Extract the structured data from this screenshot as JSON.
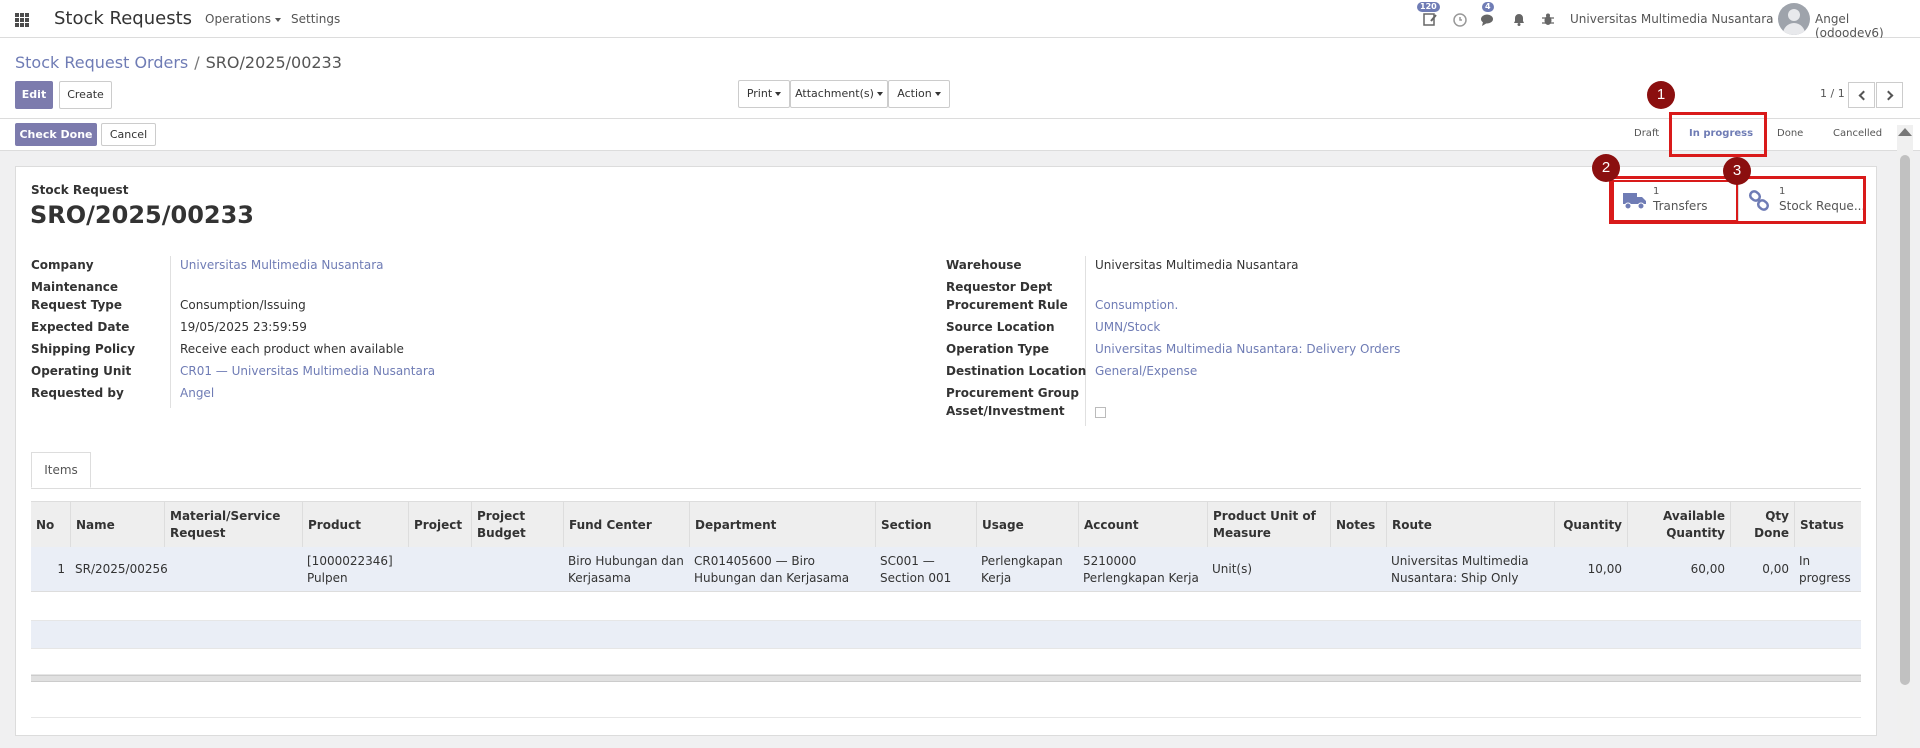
{
  "navbar": {
    "app_title": "Stock Requests",
    "menu_operations": "Operations",
    "menu_settings": "Settings",
    "activity_badge": "120",
    "messages_badge": "4",
    "company": "Universitas Multimedia Nusantara",
    "user": "Angel (odoodev6)"
  },
  "breadcrumb": {
    "parent": "Stock Request Orders",
    "separator": "/",
    "current": "SRO/2025/00233"
  },
  "toolbar": {
    "edit": "Edit",
    "create": "Create",
    "print": "Print",
    "attachments": "Attachment(s)",
    "action": "Action",
    "pager": "1 / 1"
  },
  "statusbar": {
    "check_done": "Check Done",
    "cancel": "Cancel",
    "steps": [
      "Draft",
      "In progress",
      "Done",
      "Cancelled"
    ],
    "active_step": "In progress"
  },
  "form": {
    "doc_label": "Stock Request",
    "doc_title": "SRO/2025/00233",
    "smart_buttons": [
      {
        "count": "1",
        "label": "Transfers",
        "icon": "truck-icon"
      },
      {
        "count": "1",
        "label": "Stock Reque...",
        "icon": "link-icon"
      }
    ],
    "left_fields": [
      {
        "label": "Company",
        "value": "Universitas Multimedia Nusantara",
        "link": true
      },
      {
        "label": "Maintenance Request Type",
        "value": "Consumption/Issuing",
        "link": false
      },
      {
        "label": "Expected Date",
        "value": "19/05/2025 23:59:59",
        "link": false
      },
      {
        "label": "Shipping Policy",
        "value": "Receive each product when available",
        "link": false
      },
      {
        "label": "Operating Unit",
        "value": "CR01 — Universitas Multimedia Nusantara",
        "link": true
      },
      {
        "label": "Requested by",
        "value": "Angel",
        "link": true
      }
    ],
    "right_fields": [
      {
        "label": "Warehouse",
        "value": "Universitas Multimedia Nusantara",
        "link": false
      },
      {
        "label": "Requestor Dept",
        "value": "",
        "link": false
      },
      {
        "label": "Procurement Rule",
        "value": "Consumption.",
        "link": true
      },
      {
        "label": "Source Location",
        "value": "UMN/Stock",
        "link": true
      },
      {
        "label": "Operation Type",
        "value": "Universitas Multimedia Nusantara: Delivery Orders",
        "link": true
      },
      {
        "label": "Destination Location",
        "value": "General/Expense",
        "link": true
      },
      {
        "label": "Procurement Group",
        "value": "",
        "link": false
      },
      {
        "label": "Asset/Investment",
        "value": "",
        "link": false
      }
    ]
  },
  "tabs": [
    "Items"
  ],
  "table": {
    "headers": [
      "No",
      "Name",
      "Material/Service Request",
      "Product",
      "Project",
      "Project Budget",
      "Fund Center",
      "Department",
      "Section",
      "Usage",
      "Account",
      "Product Unit of Measure",
      "Notes",
      "Route",
      "Quantity",
      "Available Quantity",
      "Qty Done",
      "Status"
    ],
    "rows": [
      [
        "1",
        "SR/2025/00256",
        "",
        "[1000022346] Pulpen",
        "",
        "",
        "Biro Hubungan dan Kerjasama",
        "CR01405600 — Biro Hubungan dan Kerjasama",
        "SC001 — Section 001",
        "Perlengkapan Kerja",
        "5210000 Perlengkapan Kerja",
        "Unit(s)",
        "",
        "Universitas Multimedia Nusantara: Ship Only",
        "10,00",
        "60,00",
        "0,00",
        "In progress"
      ]
    ]
  },
  "annotations": [
    "1",
    "2",
    "3"
  ],
  "colors": {
    "accent": "#6f7cb5",
    "primary_button": "#7c7bad",
    "highlight_box": "#d91a1a",
    "marker": "#8b0f0f"
  }
}
